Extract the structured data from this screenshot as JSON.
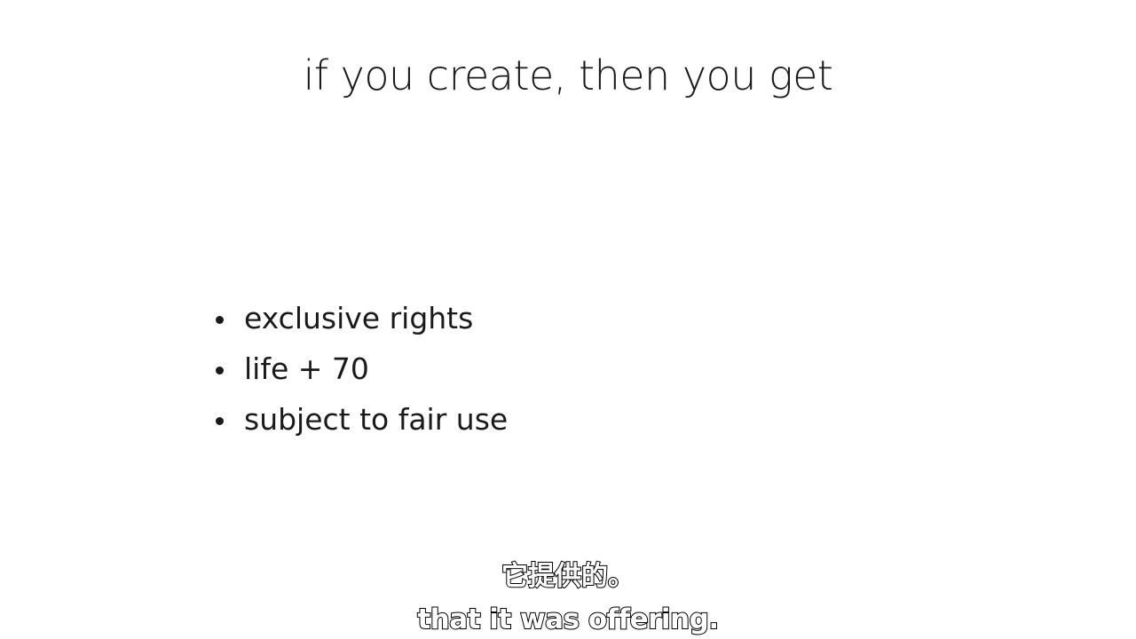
{
  "slide": {
    "title": "if you create, then you get",
    "bullets": [
      "exclusive rights",
      "life + 70",
      "subject to fair use"
    ]
  },
  "subtitles": {
    "chinese": "它提供的。",
    "english": "that it was offering."
  }
}
